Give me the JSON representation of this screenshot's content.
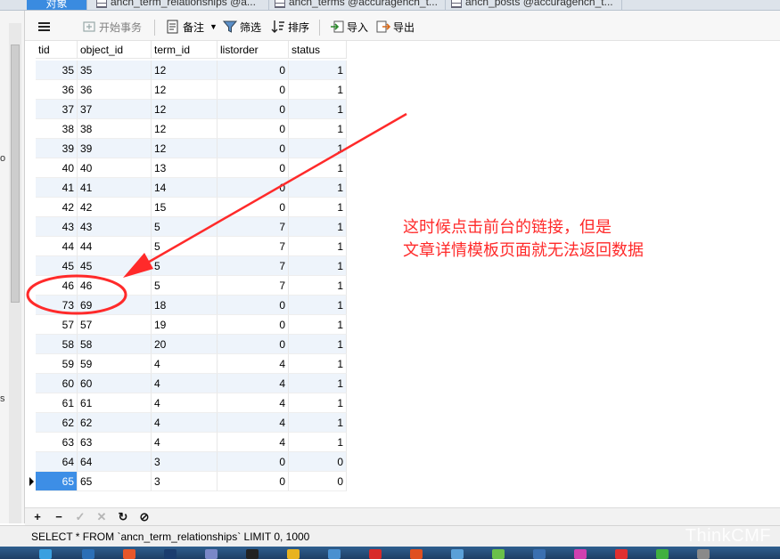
{
  "tabs": [
    {
      "label": "对象"
    },
    {
      "label": "ancn_term_relationships @a..."
    },
    {
      "label": "ancn_terms @accuragench_t..."
    },
    {
      "label": "ancn_posts @accuragench_t..."
    }
  ],
  "gutter": {
    "label_top": "o",
    "label_bottom": "s"
  },
  "toolbar": {
    "menu_icon": "hamburger-icon",
    "begin_transaction": "开始事务",
    "note": "备注",
    "filter": "筛选",
    "sort": "排序",
    "import": "导入",
    "export": "导出"
  },
  "table": {
    "columns": [
      "tid",
      "object_id",
      "term_id",
      "listorder",
      "status"
    ],
    "rows": [
      [
        "35",
        "35",
        "12",
        "0",
        "1"
      ],
      [
        "36",
        "36",
        "12",
        "0",
        "1"
      ],
      [
        "37",
        "37",
        "12",
        "0",
        "1"
      ],
      [
        "38",
        "38",
        "12",
        "0",
        "1"
      ],
      [
        "39",
        "39",
        "12",
        "0",
        "1"
      ],
      [
        "40",
        "40",
        "13",
        "0",
        "1"
      ],
      [
        "41",
        "41",
        "14",
        "0",
        "1"
      ],
      [
        "42",
        "42",
        "15",
        "0",
        "1"
      ],
      [
        "43",
        "43",
        "5",
        "7",
        "1"
      ],
      [
        "44",
        "44",
        "5",
        "7",
        "1"
      ],
      [
        "45",
        "45",
        "5",
        "7",
        "1"
      ],
      [
        "46",
        "46",
        "5",
        "7",
        "1"
      ],
      [
        "73",
        "69",
        "18",
        "0",
        "1"
      ],
      [
        "57",
        "57",
        "19",
        "0",
        "1"
      ],
      [
        "58",
        "58",
        "20",
        "0",
        "1"
      ],
      [
        "59",
        "59",
        "4",
        "4",
        "1"
      ],
      [
        "60",
        "60",
        "4",
        "4",
        "1"
      ],
      [
        "61",
        "61",
        "4",
        "4",
        "1"
      ],
      [
        "62",
        "62",
        "4",
        "4",
        "1"
      ],
      [
        "63",
        "63",
        "4",
        "4",
        "1"
      ],
      [
        "64",
        "64",
        "3",
        "0",
        "0"
      ],
      [
        "65",
        "65",
        "3",
        "0",
        "0"
      ]
    ],
    "selected_row": 21
  },
  "annotation": {
    "line1": "这时候点击前台的链接，但是",
    "line2": "文章详情模板页面就无法返回数据",
    "color": "#ff2a2a"
  },
  "nav": {
    "add": "+",
    "delete": "−",
    "apply": "✓",
    "cancel": "✕",
    "refresh": "↻",
    "stop": "⊘"
  },
  "status": {
    "sql": "SELECT * FROM `ancn_term_relationships` LIMIT 0, 1000"
  },
  "watermark": "ThinkCMF",
  "colors": {
    "selection": "#3d8ee6",
    "alt_row": "#eef4fb",
    "active_tab": "#3a8be0"
  }
}
